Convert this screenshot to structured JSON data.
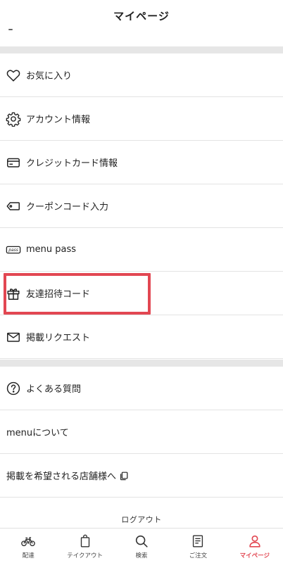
{
  "header": {
    "title": "マイページ"
  },
  "menu": {
    "favorites": "お気に入り",
    "account": "アカウント情報",
    "credit_card": "クレジットカード情報",
    "coupon": "クーポンコード入力",
    "menu_pass": "menu pass",
    "pass_badge": "pass",
    "invite": "友達招待コード",
    "listing_request": "掲載リクエスト",
    "faq": "よくある質問",
    "about": "menuについて",
    "for_stores": "掲載を希望される店舗様へ",
    "logout": "ログアウト"
  },
  "tabs": [
    {
      "label": "配達",
      "icon": "bicycle-icon"
    },
    {
      "label": "テイクアウト",
      "icon": "shopping-bag-icon"
    },
    {
      "label": "検索",
      "icon": "search-icon"
    },
    {
      "label": "ご注文",
      "icon": "receipt-icon"
    },
    {
      "label": "マイページ",
      "icon": "person-icon"
    }
  ],
  "colors": {
    "accent": "#e24752",
    "separator": "#e6e6e6",
    "divider": "#e3e3e3"
  },
  "active_tab": "マイページ"
}
